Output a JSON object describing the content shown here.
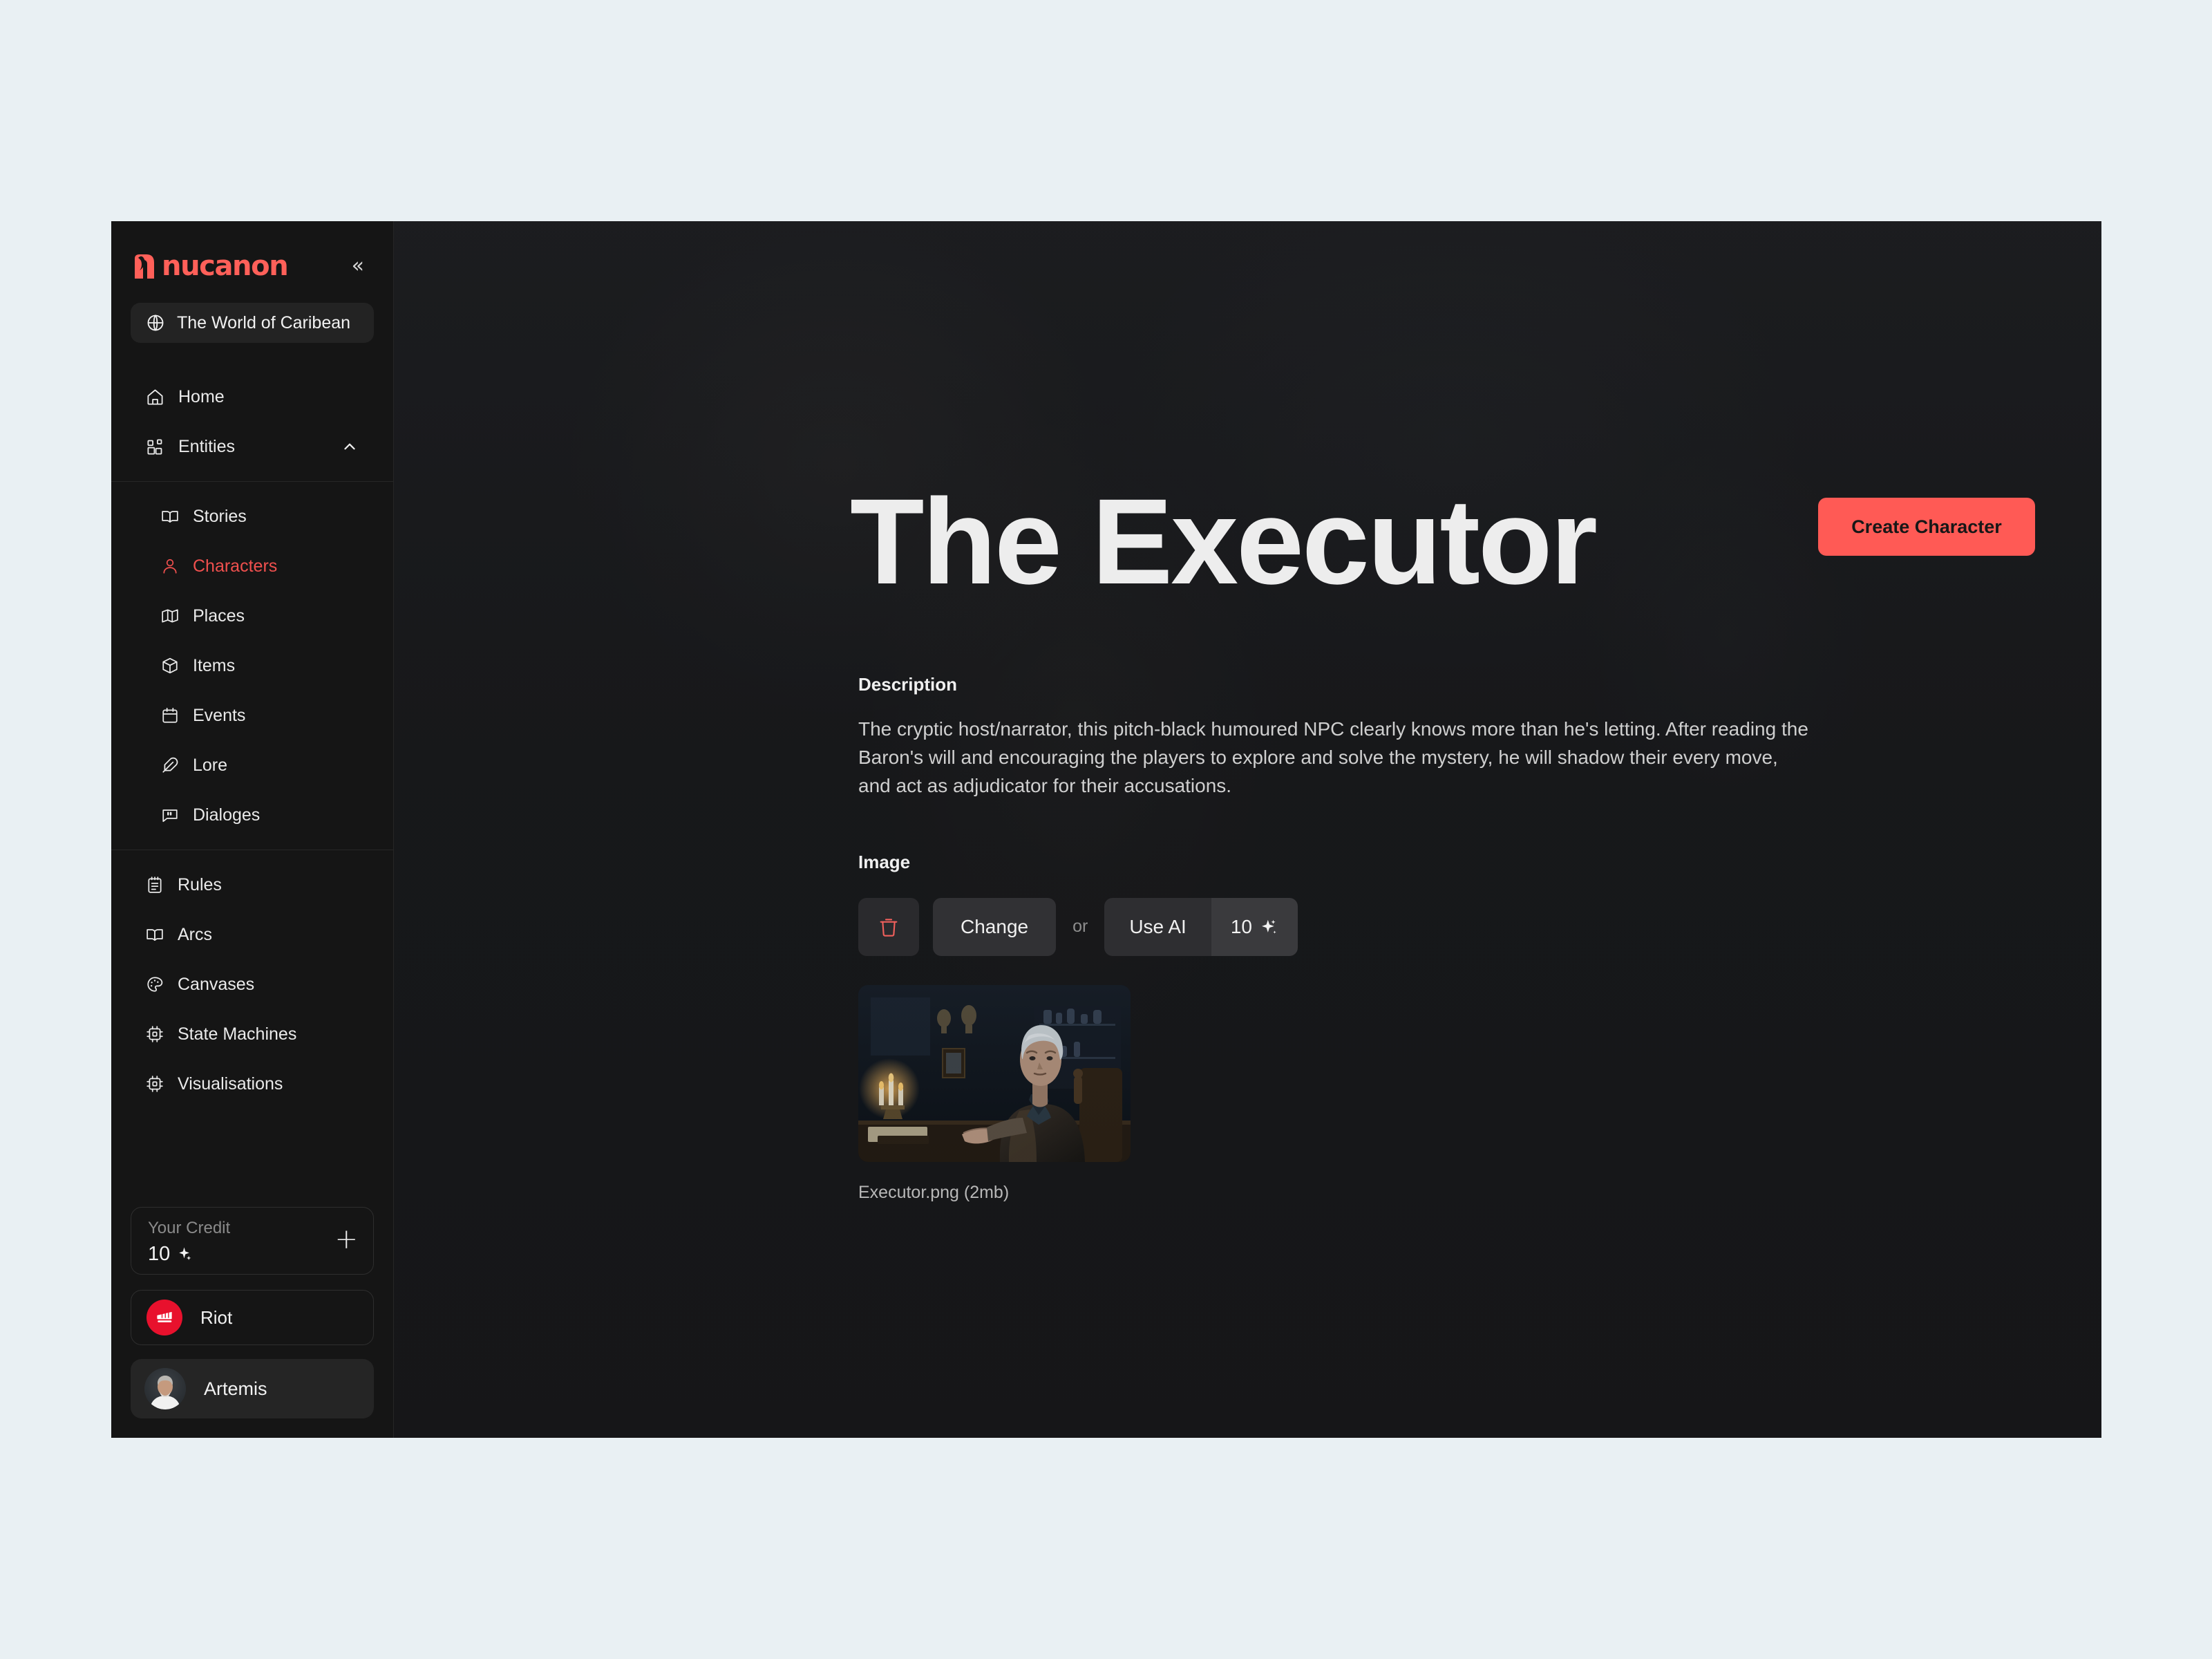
{
  "colors": {
    "page_background": "#e9f0f3",
    "app_background": "#181818",
    "sidebar_background": "#151515",
    "accent": "#ff5a55",
    "active_nav": "#f0504e",
    "riot_red": "#e8112d"
  },
  "sidebar": {
    "brand": "nucanon",
    "collapse_icon": "chevrons-left-icon",
    "world_selector": {
      "icon": "globe-icon",
      "label": "The World of Caribean"
    },
    "nav": [
      {
        "label": "Home",
        "icon": "home-icon",
        "active": false
      },
      {
        "label": "Entities",
        "icon": "blocks-icon",
        "active": false,
        "expanded": true,
        "chevron": "chevron-up-icon"
      }
    ],
    "entities_children": [
      {
        "label": "Stories",
        "icon": "book-open-icon",
        "active": false
      },
      {
        "label": "Characters",
        "icon": "user-icon",
        "active": true
      },
      {
        "label": "Places",
        "icon": "map-icon",
        "active": false
      },
      {
        "label": "Items",
        "icon": "box-icon",
        "active": false
      },
      {
        "label": "Events",
        "icon": "calendar-icon",
        "active": false
      },
      {
        "label": "Lore",
        "icon": "feather-icon",
        "active": false
      },
      {
        "label": "Dialoges",
        "icon": "message-quote-icon",
        "active": false
      }
    ],
    "tools": [
      {
        "label": "Rules",
        "icon": "notepad-icon",
        "active": false
      },
      {
        "label": "Arcs",
        "icon": "book-open-icon",
        "active": false
      },
      {
        "label": "Canvases",
        "icon": "palette-icon",
        "active": false
      },
      {
        "label": "State Machines",
        "icon": "cpu-icon",
        "active": false
      },
      {
        "label": "Visualisations",
        "icon": "cpu-icon",
        "active": false
      }
    ],
    "credit": {
      "label": "Your Credit",
      "value": "10",
      "value_icon": "sparkle-icon",
      "add_icon": "plus-icon"
    },
    "org": {
      "name": "Riot",
      "icon": "riot-fist-icon"
    },
    "user": {
      "name": "Artemis",
      "avatar": "user-avatar"
    }
  },
  "main": {
    "create_button": "Create Character",
    "title": "The Executor",
    "description_label": "Description",
    "description": "The cryptic host/narrator, this pitch-black humoured NPC clearly knows more than he's letting. After reading the Baron's will and encouraging the players to explore and solve the mystery, he will shadow their every move, and act as adjudicator for their accusations.",
    "image_label": "Image",
    "delete_icon": "trash-icon",
    "change_button": "Change",
    "or_text": "or",
    "use_ai_button": "Use AI",
    "ai_cost": "10",
    "ai_cost_icon": "sparkle-icon",
    "thumbnail_alt": "executor-portrait",
    "filename": "Executor.png (2mb)"
  }
}
